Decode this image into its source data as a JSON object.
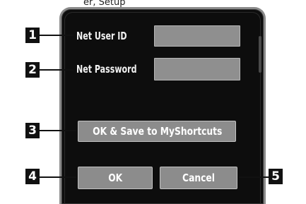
{
  "top_text": "er, Setup",
  "form": {
    "net_user_id_label": "Net User ID",
    "net_password_label": "Net Password",
    "net_user_id_value": "",
    "net_password_value": ""
  },
  "buttons": {
    "ok_save_label": "OK & Save to MyShortcuts",
    "ok_label": "OK",
    "cancel_label": "Cancel"
  },
  "callouts": [
    "1",
    "2",
    "3",
    "4",
    "5"
  ]
}
